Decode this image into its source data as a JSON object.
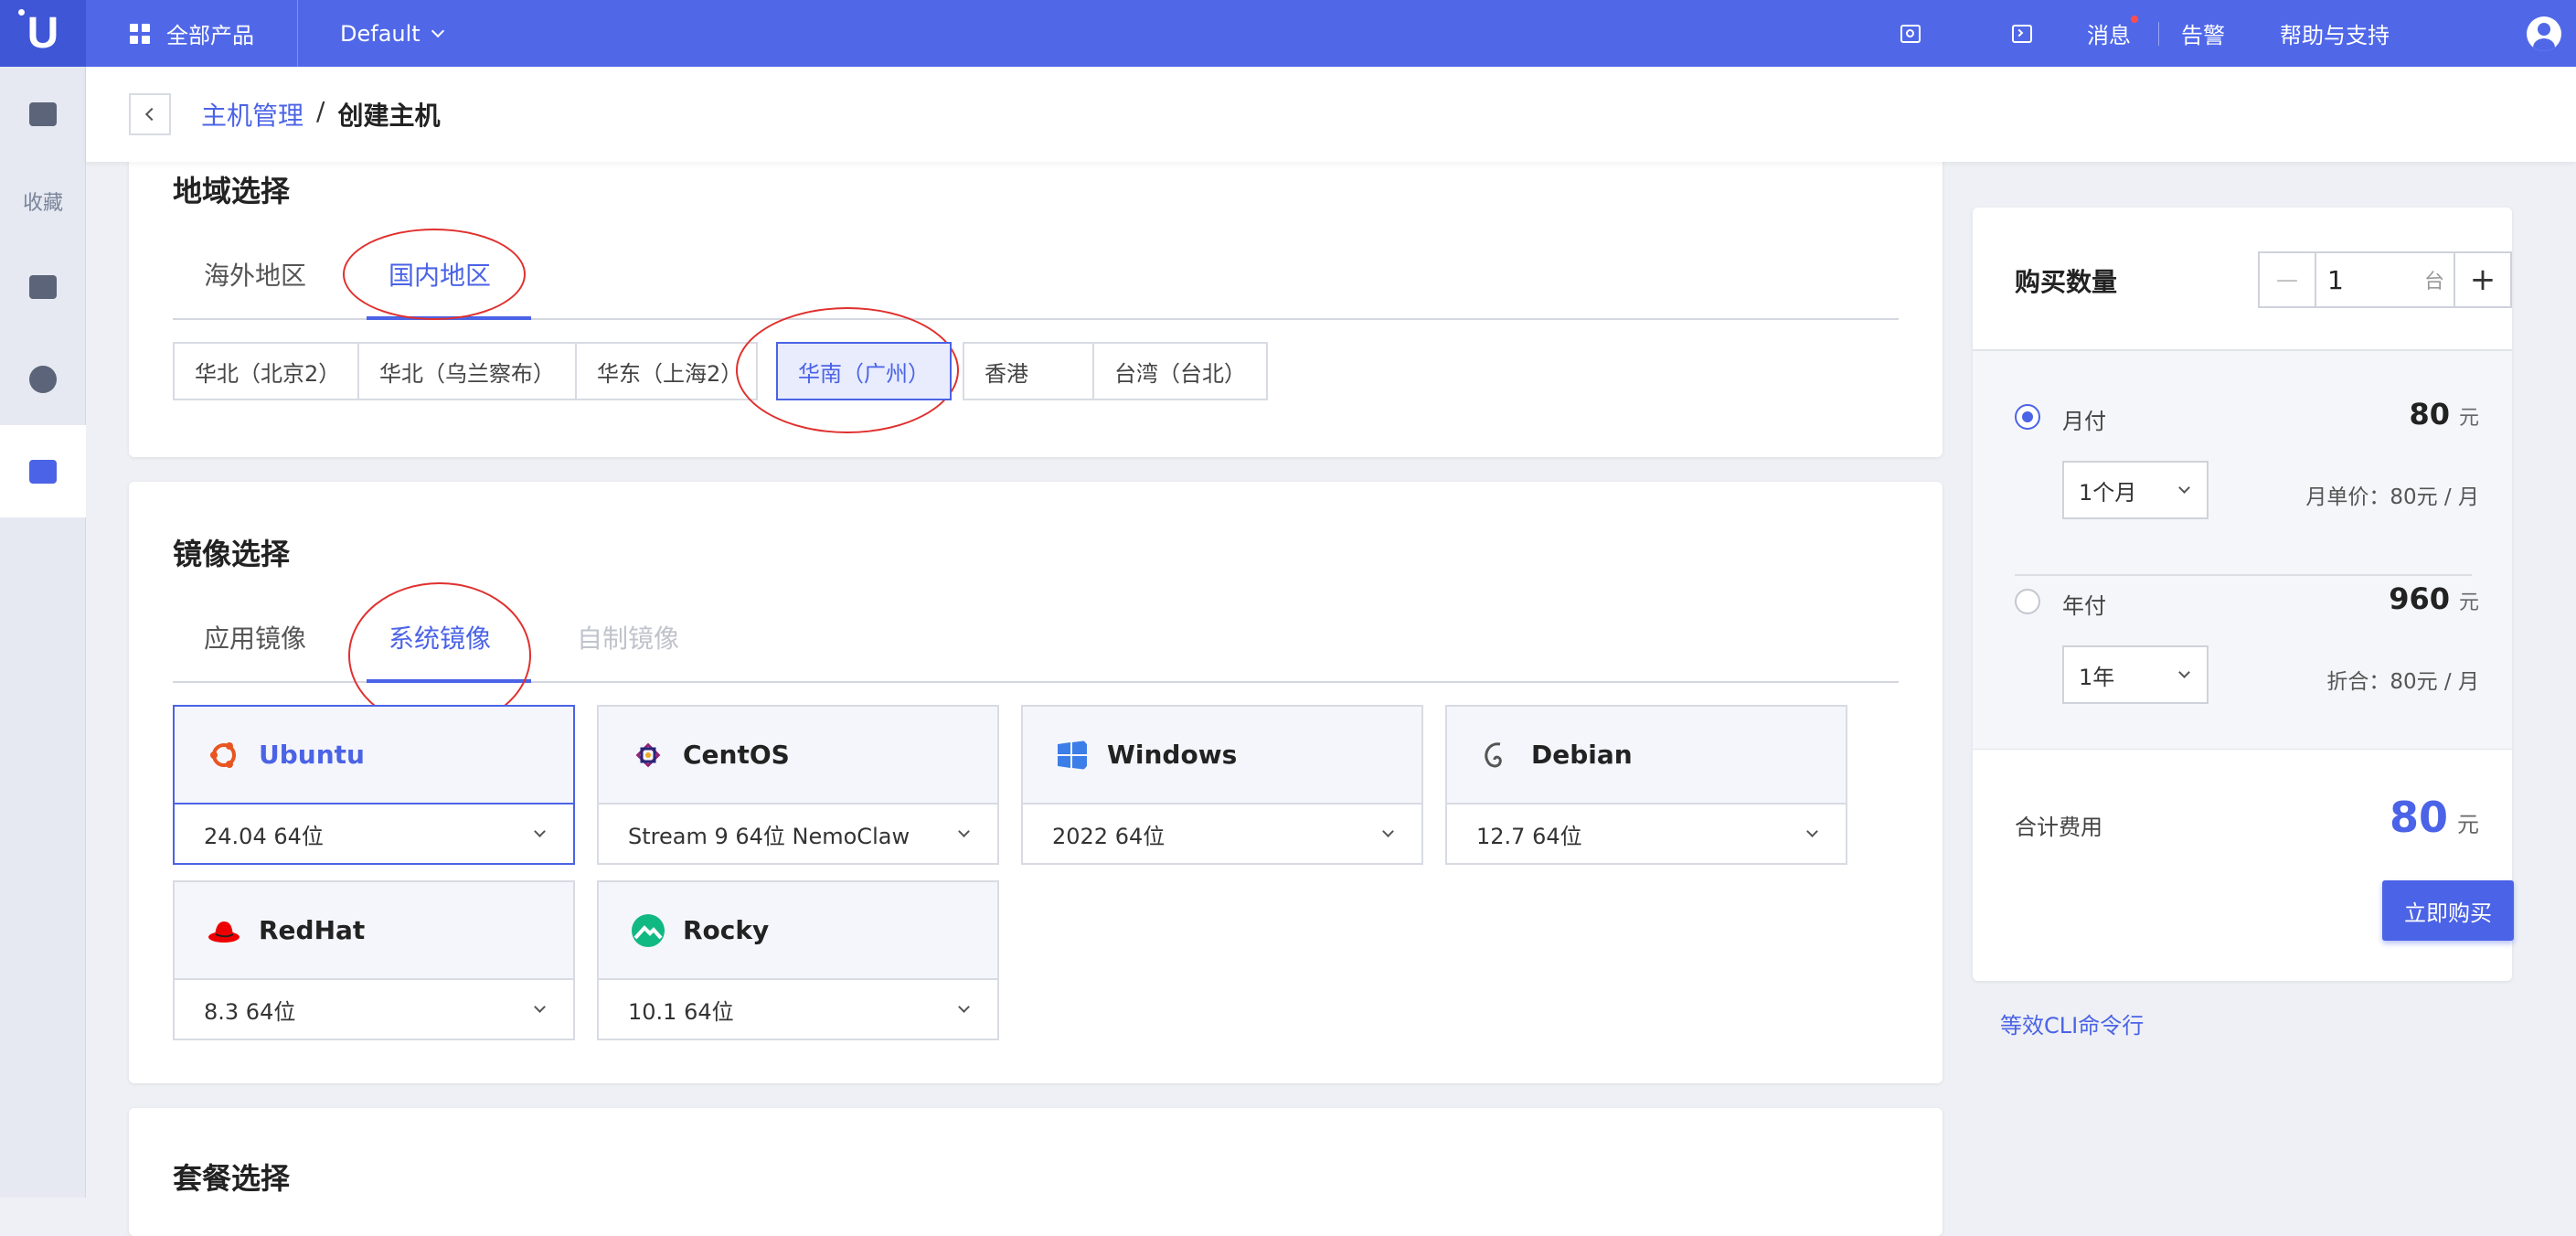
{
  "topbar": {
    "logo": "U",
    "all_products": "全部产品",
    "project": "Default",
    "messages": "消息",
    "alerts": "告警",
    "help": "帮助与支持"
  },
  "sidebar": {
    "favorites": "收藏"
  },
  "breadcrumb": {
    "parent": "主机管理",
    "separator": "/",
    "current": "创建主机"
  },
  "region_section": {
    "title": "地域选择",
    "tabs": [
      "海外地区",
      "国内地区"
    ],
    "active_tab": "国内地区",
    "regions": [
      "华北（北京2）",
      "华北（乌兰察布）",
      "华东（上海2）",
      "华南（广州）",
      "香港",
      "台湾（台北）"
    ],
    "selected_region": "华南（广州）"
  },
  "image_section": {
    "title": "镜像选择",
    "tabs": [
      "应用镜像",
      "系统镜像",
      "自制镜像"
    ],
    "active_tab": "系统镜像",
    "images": [
      {
        "name": "Ubuntu",
        "version": "24.04 64位",
        "color": "#e95420"
      },
      {
        "name": "CentOS",
        "version": "Stream 9 64位 NemoClaw",
        "color": "#932279"
      },
      {
        "name": "Windows",
        "version": "2022 64位",
        "color": "#0078d4"
      },
      {
        "name": "Debian",
        "version": "12.7 64位",
        "color": "#a80030"
      },
      {
        "name": "RedHat",
        "version": "8.3 64位",
        "color": "#ee0000"
      },
      {
        "name": "Rocky",
        "version": "10.1 64位",
        "color": "#10b981"
      }
    ],
    "selected_image": "Ubuntu"
  },
  "package_section": {
    "title": "套餐选择"
  },
  "order_panel": {
    "quantity_label": "购买数量",
    "quantity": "1",
    "quantity_unit": "台",
    "minus": "—",
    "plus": "+",
    "monthly": {
      "label": "月付",
      "price": "80",
      "currency": "元",
      "period": "1个月",
      "unit_price": "月单价：80元 / 月",
      "selected": true
    },
    "yearly": {
      "label": "年付",
      "price": "960",
      "currency": "元",
      "period": "1年",
      "unit_price": "折合：80元 / 月",
      "selected": false
    },
    "total_label": "合计费用",
    "total": "80",
    "total_currency": "元",
    "buy_button": "立即购买",
    "cli_link": "等效CLI命令行"
  },
  "colors": {
    "primary": "#4b63e6",
    "topbar": "#5068e8",
    "annotation_red": "#e0302e"
  }
}
